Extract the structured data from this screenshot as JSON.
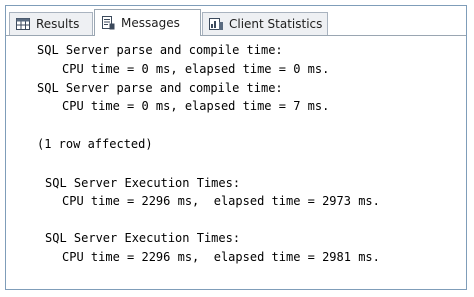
{
  "tabs": [
    {
      "label": "Results",
      "icon": "grid-icon",
      "active": false
    },
    {
      "label": "Messages",
      "icon": "messages-icon",
      "active": true
    },
    {
      "label": "Client Statistics",
      "icon": "client-statistics-icon",
      "active": false
    }
  ],
  "messages": [
    "SQL Server parse and compile time:",
    "CPU time = 0 ms, elapsed time = 0 ms.",
    "SQL Server parse and compile time:",
    "CPU time = 0 ms, elapsed time = 7 ms.",
    "(1 row affected)",
    "SQL Server Execution Times:",
    "CPU time = 2296 ms,  elapsed time = 2973 ms.",
    "SQL Server Execution Times:",
    "CPU time = 2296 ms,  elapsed time = 2981 ms."
  ]
}
